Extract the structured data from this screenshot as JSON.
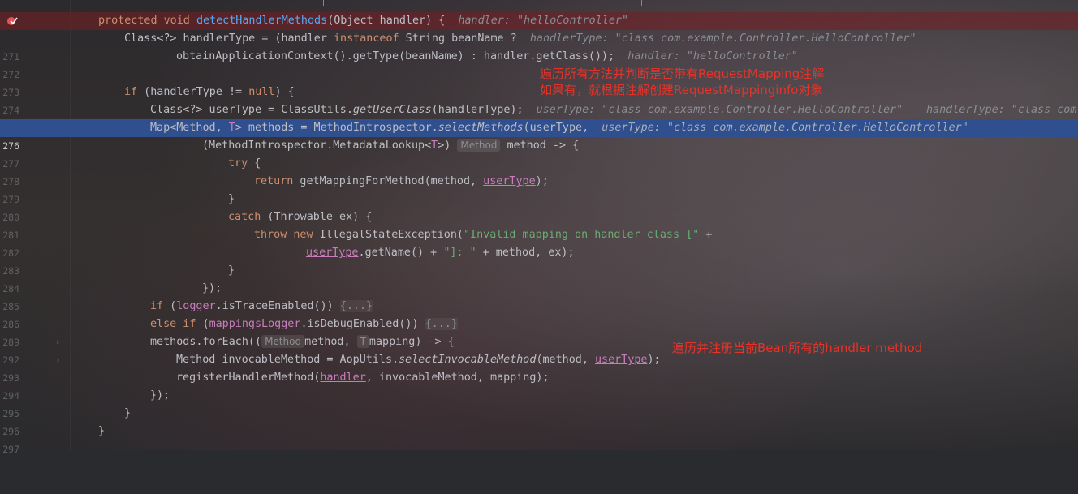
{
  "annotations": {
    "note1_line1": "遍历所有方法并判断是否带有RequestMapping注解",
    "note1_line2": "如果有，就根据注解创建RequestMappinginfo对象",
    "note2": "遍历并注册当前Bean所有的handler method"
  },
  "colors": {
    "keyword": "#cf8e6d",
    "method": "#56a8f5",
    "string": "#6aab73",
    "highlight_line": "#2f4f8f",
    "breakpoint_line": "#7a1e23",
    "annotation": "#e6332a"
  },
  "lines": [
    {
      "num": "",
      "breakpoint": true,
      "p1": "protected",
      "p2": " ",
      "p3": "void",
      "p4": " ",
      "p5": "detectHandlerMethods",
      "p6": "(Object handler) {",
      "hint": "handler: \"helloController\""
    },
    {
      "num": "271",
      "a": "Class<?> handlerType = (handler ",
      "b": "instanceof",
      "c": " String beanName ?",
      "hint": "handlerType: \"class com.example.Controller.HelloController\""
    },
    {
      "num": "272",
      "a": "obtainApplicationContext().getType(beanName) : handler.getClass());",
      "hint": "handler: \"helloController\""
    },
    {
      "num": "273"
    },
    {
      "num": "274",
      "a": "if",
      "b": " (handlerType != ",
      "c": "null",
      "d": ") {"
    },
    {
      "num": "275",
      "a": "Class<?> userType = ClassUtils.",
      "b": "getUserClass",
      "c": "(handlerType);",
      "hint": "userType: \"class com.example.Controller.HelloController\"",
      "hint2": "handlerType: \"class com"
    },
    {
      "num": "276",
      "a": "Map<Method, ",
      "b": "T",
      "c": "> methods = MethodIntrospector.",
      "d": "selectMethods",
      "e": "(userType,",
      "hint": "userType: \"class com.example.Controller.HelloController\""
    },
    {
      "num": "277",
      "a": "(MethodIntrospector.MetadataLookup<",
      "b": "T",
      "c": ">)",
      "tag": "Method",
      "d": "method -> {"
    },
    {
      "num": "278",
      "a": "try",
      "b": " {"
    },
    {
      "num": "279",
      "a": "return",
      "b": " getMappingForMethod(method, ",
      "c": "userType",
      "d": ");"
    },
    {
      "num": "280",
      "a": "}"
    },
    {
      "num": "281",
      "a": "catch",
      "b": " (Throwable ex) {"
    },
    {
      "num": "282",
      "a": "throw",
      "b": " ",
      "c": "new",
      "d": " IllegalStateException(",
      "e": "\"Invalid mapping on handler class [\"",
      "f": " +"
    },
    {
      "num": "283",
      "a": "userType",
      "b": ".getName() + ",
      "c": "\"]: \"",
      "d": " + method, ex);"
    },
    {
      "num": "284",
      "a": "}"
    },
    {
      "num": "285",
      "a": "});"
    },
    {
      "num": "286",
      "a": "if",
      "b": " (",
      "c": "logger",
      "d": ".isTraceEnabled())",
      "fold": "{...}"
    },
    {
      "num": "289",
      "a": "else if",
      "b": " (",
      "c": "mappingsLogger",
      "d": ".isDebugEnabled())",
      "fold": "{...}"
    },
    {
      "num": "292",
      "a": "methods.forEach((",
      "tag": "Method",
      "b": "method, ",
      "tag2": "T",
      "c": "mapping) -> {"
    },
    {
      "num": "293",
      "a": "Method invocableMethod = AopUtils.",
      "b": "selectInvocableMethod",
      "c": "(method, ",
      "d": "userType",
      "e": ");"
    },
    {
      "num": "294",
      "a": "registerHandlerMethod(",
      "b": "handler",
      "c": ", invocableMethod, mapping);"
    },
    {
      "num": "295",
      "a": "});"
    },
    {
      "num": "296",
      "a": "}"
    },
    {
      "num": "297",
      "a": "}"
    }
  ]
}
